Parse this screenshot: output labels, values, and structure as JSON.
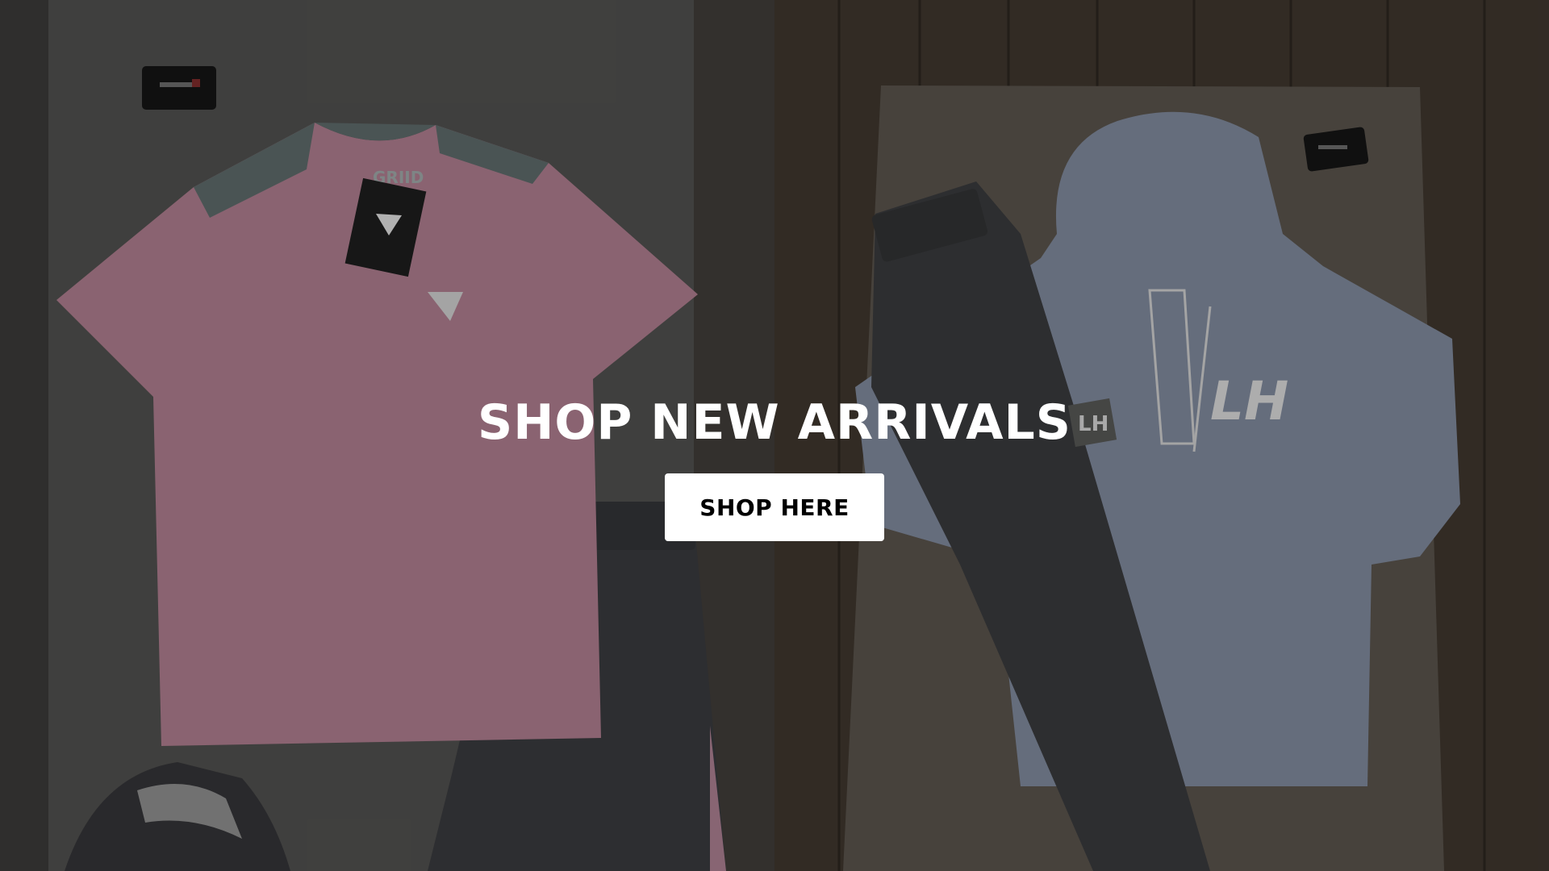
{
  "hero": {
    "headline": "SHOP NEW ARRIVALS",
    "cta_label": "SHOP HERE",
    "tee_brand": "GRIID",
    "hoodie_logo": "LH"
  },
  "colors": {
    "overlay": "#000000",
    "headline_text": "#ffffff",
    "cta_background": "#ffffff",
    "cta_text": "#000000",
    "tee_pink": "#c98ba0",
    "hoodie_blue": "#8d9bb8",
    "joggers_grey": "#3f3f42"
  }
}
